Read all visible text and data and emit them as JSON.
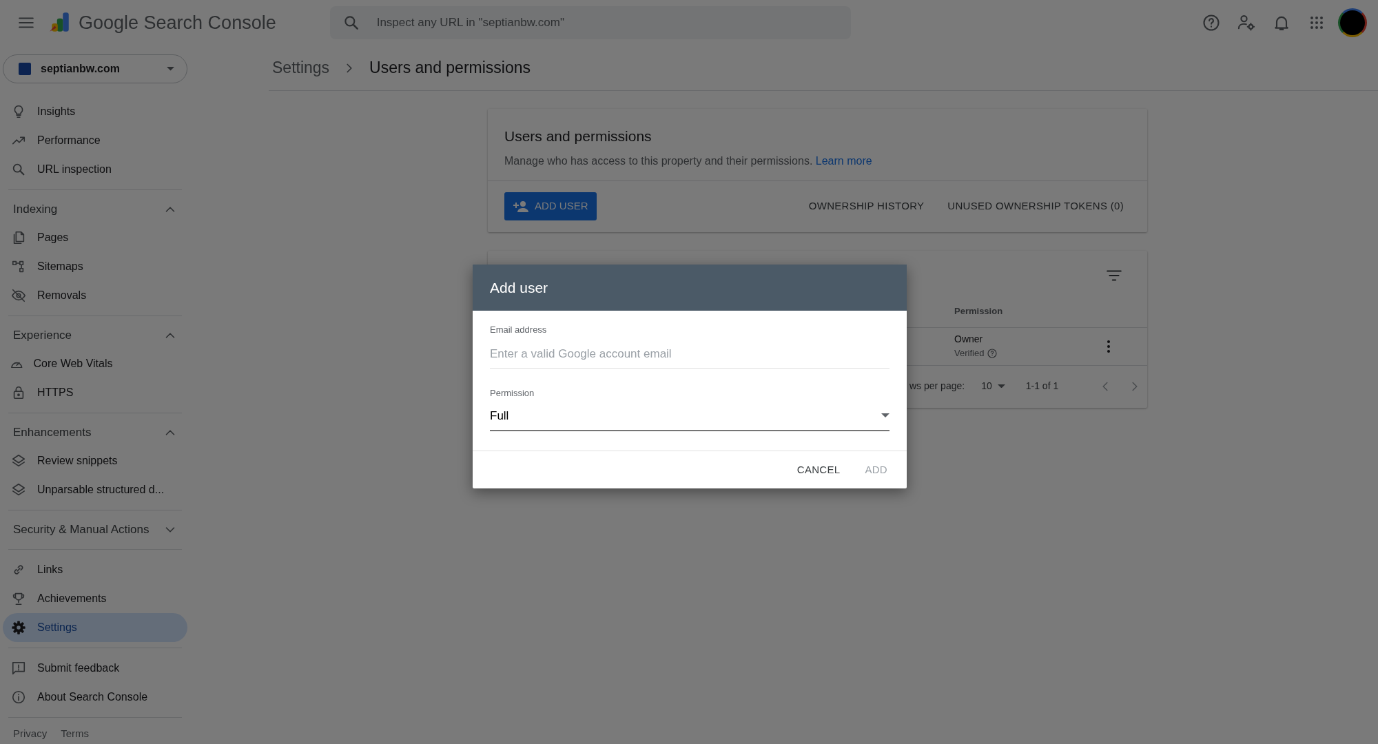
{
  "app": {
    "title": "Google Search Console"
  },
  "search": {
    "placeholder": "Inspect any URL in \"septianbw.com\""
  },
  "property": {
    "name": "septianbw.com"
  },
  "sidebar": {
    "groups": [
      {
        "items": [
          {
            "label": "Insights",
            "selected": false
          },
          {
            "label": "Performance",
            "selected": false
          },
          {
            "label": "URL inspection",
            "selected": false
          }
        ]
      },
      {
        "title": "Indexing",
        "expanded": true,
        "items": [
          {
            "label": "Pages",
            "selected": false
          },
          {
            "label": "Sitemaps",
            "selected": false
          },
          {
            "label": "Removals",
            "selected": false
          }
        ]
      },
      {
        "title": "Experience",
        "expanded": true,
        "items": [
          {
            "label": "Core Web Vitals",
            "selected": false
          },
          {
            "label": "HTTPS",
            "selected": false
          }
        ]
      },
      {
        "title": "Enhancements",
        "expanded": true,
        "items": [
          {
            "label": "Review snippets",
            "selected": false
          },
          {
            "label": "Unparsable structured d...",
            "selected": false
          }
        ]
      },
      {
        "title": "Security & Manual Actions",
        "expanded": false
      },
      {
        "items": [
          {
            "label": "Links",
            "selected": false
          },
          {
            "label": "Achievements",
            "selected": false
          },
          {
            "label": "Settings",
            "selected": true
          }
        ]
      },
      {
        "items": [
          {
            "label": "Submit feedback",
            "selected": false
          },
          {
            "label": "About Search Console",
            "selected": false
          }
        ]
      }
    ],
    "footer_links": [
      "Privacy",
      "Terms"
    ]
  },
  "breadcrumb": [
    "Settings",
    "Users and permissions"
  ],
  "users_card": {
    "title": "Users and permissions",
    "description": "Manage who has access to this property and their permissions.",
    "link": "Learn more",
    "primary_action": "ADD USER",
    "actions": [
      "OWNERSHIP HISTORY",
      "UNUSED OWNERSHIP TOKENS (0)"
    ]
  },
  "table": {
    "columns": [
      "Permission"
    ],
    "rows": [
      {
        "permission": "Owner",
        "status": "Verified"
      }
    ],
    "pagination": {
      "rows_per_page_label": "ws per page:",
      "rows_per_page": "10",
      "range": "1-1 of 1"
    }
  },
  "dialog": {
    "title": "Add user",
    "fields": [
      {
        "kind": "text",
        "label": "Email address",
        "placeholder": "Enter a valid Google account email"
      },
      {
        "kind": "select",
        "label": "Permission",
        "value": "Full"
      }
    ],
    "buttons": [
      {
        "label": "CANCEL",
        "disabled": false
      },
      {
        "label": "ADD",
        "disabled": true
      }
    ]
  }
}
